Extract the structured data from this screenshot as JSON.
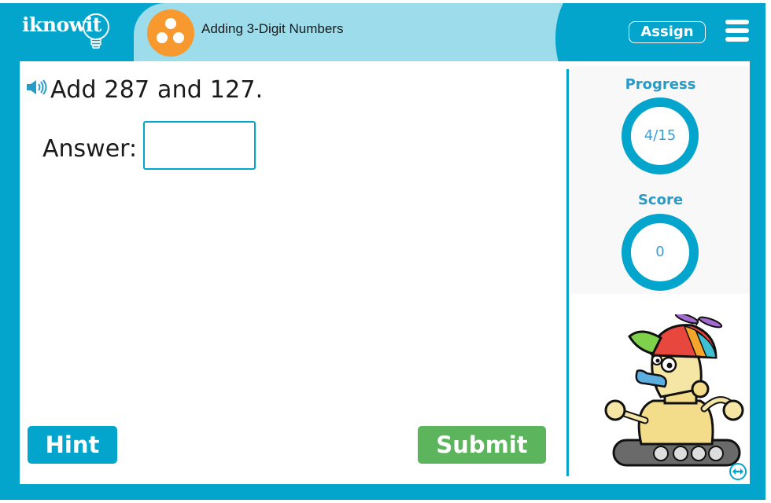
{
  "header": {
    "logo_text": "iknowit",
    "topic_title": "Adding 3-Digit Numbers",
    "topic_icon": "three-dots-circle-icon",
    "assign_label": "Assign",
    "menu_icon": "hamburger-menu-icon"
  },
  "question": {
    "speaker_icon": "speaker-icon",
    "text": "Add 287 and 127.",
    "answer_label": "Answer:",
    "answer_value": "",
    "answer_placeholder": ""
  },
  "buttons": {
    "hint_label": "Hint",
    "submit_label": "Submit"
  },
  "sidebar": {
    "progress_label": "Progress",
    "progress_value": "4/15",
    "progress_current": 4,
    "progress_total": 15,
    "score_label": "Score",
    "score_value": "0",
    "mascot": "robot-mascot-with-propeller-cap",
    "expand_icon": "expand-horizontal-icon"
  },
  "colors": {
    "brand_blue": "#03a5cc",
    "title_band": "#9cdceb",
    "topic_orange": "#f7992e",
    "submit_green": "#5cb45c",
    "stat_text": "#2a9ac7"
  }
}
